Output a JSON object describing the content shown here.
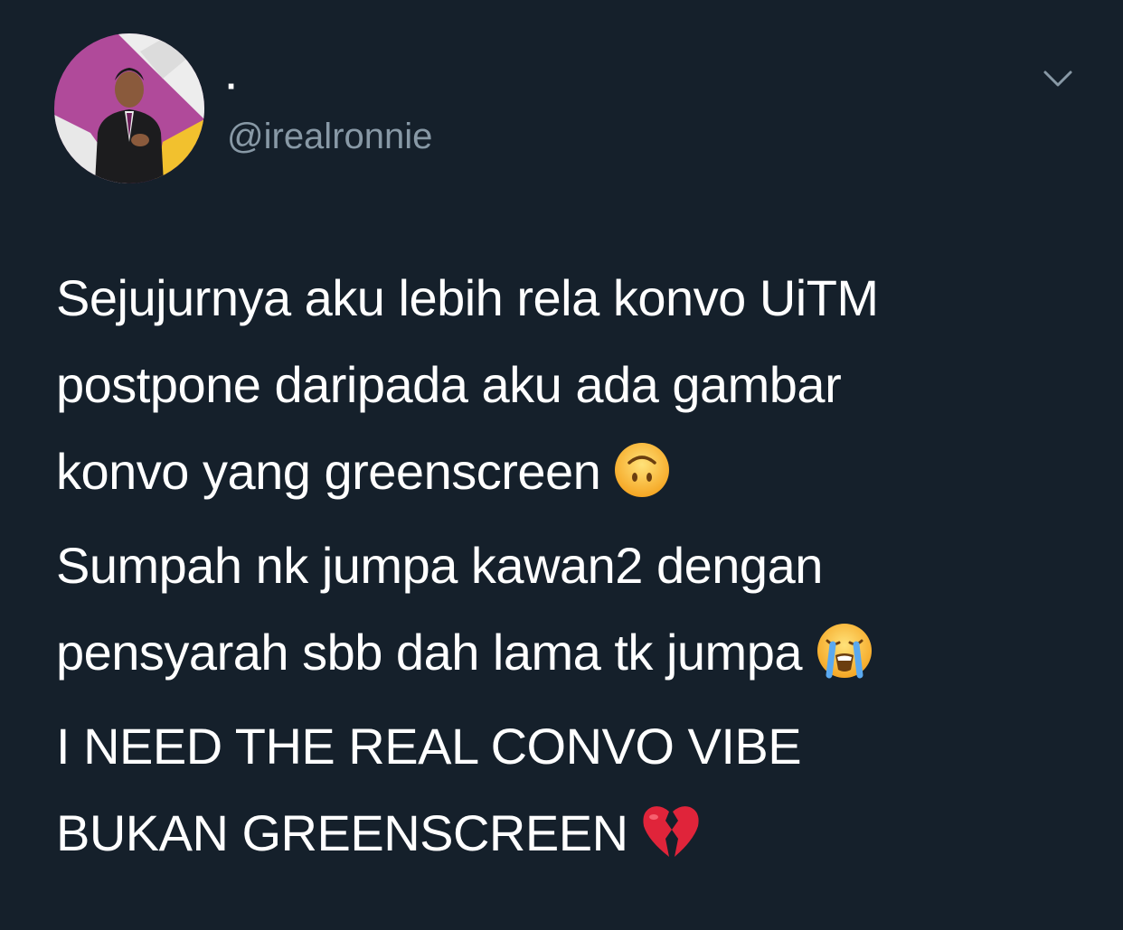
{
  "tweet": {
    "display_name": "·",
    "handle": "@irealronnie",
    "paragraphs": [
      {
        "lines": [
          "Sejujurnya aku lebih rela konvo UiTM",
          "postpone daripada aku ada gambar",
          "konvo yang greenscreen"
        ],
        "emoji": "upside-down-face-emoji"
      },
      {
        "lines": [
          "Sumpah nk jumpa kawan2 dengan",
          "pensyarah sbb dah lama tk jumpa"
        ],
        "emoji": "loudly-crying-face-emoji"
      },
      {
        "lines": [
          "I NEED THE REAL CONVO VIBE",
          "BUKAN GREENSCREEN"
        ],
        "emoji": "broken-heart-emoji"
      }
    ],
    "menu_icon": "chevron-down-icon"
  },
  "colors": {
    "background": "#15202b",
    "text": "#ffffff",
    "secondary_text": "#8899a6"
  }
}
